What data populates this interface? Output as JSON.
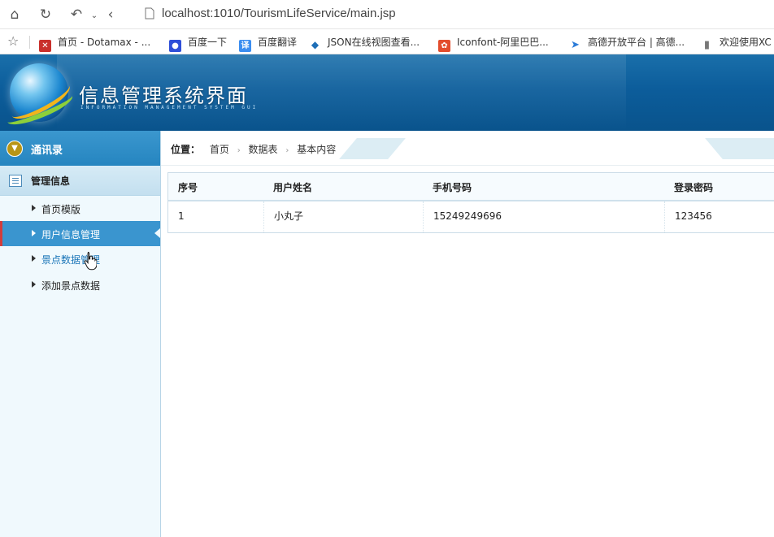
{
  "browser": {
    "url": "localhost:1010/TourismLifeService/main.jsp",
    "bookmarks": [
      "首页 - Dotamax - ...",
      "百度一下",
      "百度翻译",
      "JSON在线视图查看...",
      "Iconfont-阿里巴巴...",
      "高德开放平台 | 高德...",
      "欢迎使用XC"
    ]
  },
  "header": {
    "title": "信息管理系统界面",
    "subtitle": "INFORMATION MANAGEMENT SYSTEM GUI"
  },
  "sidebar": {
    "contacts_label": "通讯录",
    "manage_label": "管理信息",
    "items": [
      {
        "label": "首页模版"
      },
      {
        "label": "用户信息管理"
      },
      {
        "label": "景点数据管理"
      },
      {
        "label": "添加景点数据"
      }
    ],
    "active_index": 1
  },
  "breadcrumb": {
    "position_label": "位置：",
    "items": [
      "首页",
      "数据表",
      "基本内容"
    ]
  },
  "table": {
    "headers": [
      "序号",
      "用户姓名",
      "手机号码",
      "登录密码"
    ],
    "rows": [
      [
        "1",
        "小丸子",
        "15249249696",
        "123456"
      ]
    ]
  },
  "colors": {
    "header_blue": "#0c5d9b",
    "active_item": "#3a95cf",
    "active_marker": "#d23c3c"
  }
}
